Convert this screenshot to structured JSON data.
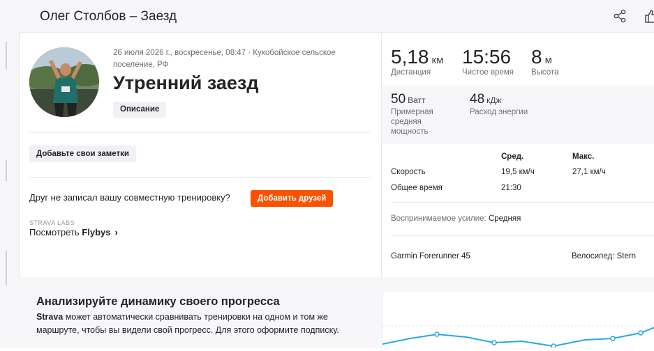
{
  "header": {
    "title": "Олег Столбов – Заезд",
    "share_icon": "share-icon",
    "kudos_icon": "thumbs-up-icon"
  },
  "activity": {
    "meta": "26 июля 2026 г., воскресенье, 08:47 · Кукобойское сельское поселение, РФ",
    "title": "Утренний заезд",
    "description_label": "Описание",
    "notes_label": "Добавьте свои заметки",
    "friend_prompt": "Друг не записал вашу совместную тренировку?",
    "add_friends_label": "Добавить друзей",
    "labs_label": "STRAVA LABS",
    "flybys_prefix": "Посмотреть ",
    "flybys_word": "Flybys"
  },
  "stats": {
    "distance": {
      "value": "5,18",
      "unit": "км",
      "label": "Дистанция"
    },
    "moving_time": {
      "value": "15:56",
      "label": "Чистое время"
    },
    "elevation": {
      "value": "8",
      "unit": "м",
      "label": "Высота"
    },
    "power": {
      "value": "50",
      "unit": "Ватт",
      "label": "Примерная средняя мощность"
    },
    "energy": {
      "value": "48",
      "unit": "кДж",
      "label": "Расход энергии"
    }
  },
  "table": {
    "col_avg": "Сред.",
    "col_max": "Макс.",
    "rows": [
      {
        "label": "Скорость",
        "avg": "19,5 км/ч",
        "max": "27,1 км/ч"
      },
      {
        "label": "Общее время",
        "avg": "21:30",
        "max": ""
      }
    ]
  },
  "effort": {
    "label": "Воспринимаемое усилие:",
    "value": "Средняя"
  },
  "device": "Garmin Forerunner 45",
  "bike": {
    "label": "Велосипед:",
    "value": "Stern"
  },
  "banner": {
    "title": "Анализируйте динамику своего прогресса",
    "brand": "Strava",
    "body": " может автоматически сравнивать тренировки на одном и том же маршруте, чтобы вы видели свой прогресс. Для этого оформите подписку."
  },
  "colors": {
    "accent": "#fc5200",
    "line": "#27a7e7"
  }
}
